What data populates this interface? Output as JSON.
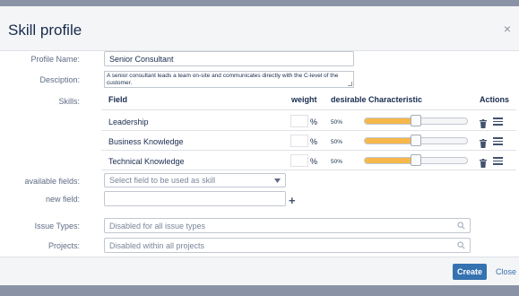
{
  "dialog": {
    "title": "Skill profile",
    "close_symbol": "×"
  },
  "form": {
    "profile_name_label": "Profile Name:",
    "profile_name_value": "Senior Consultant",
    "description_label": "Desciption:",
    "description_value": "A senior consultant leads a team on-site and communicates directly with the C-level of the customer.",
    "skills_label": "Skills:",
    "available_fields_label": "available fields:",
    "available_fields_placeholder": "Select field to be used as skill",
    "new_field_label": "new field:",
    "new_field_value": "",
    "add_symbol": "+",
    "issue_types_label": "Issue Types:",
    "issue_types_value": "Disabled for all issue types",
    "projects_label": "Projects:",
    "projects_value": "Disabled within all projects"
  },
  "table": {
    "headers": {
      "field": "Field",
      "weight": "weight",
      "characteristic": "desirable Characteristic",
      "actions": "Actions"
    },
    "percent_symbol": "%",
    "rows": [
      {
        "field": "Leadership",
        "weight": "",
        "characteristic": "50%",
        "level": 0.5
      },
      {
        "field": "Business Knowledge",
        "weight": "",
        "characteristic": "50%",
        "level": 0.5
      },
      {
        "field": "Technical Knowledge",
        "weight": "",
        "characteristic": "50%",
        "level": 0.5
      }
    ]
  },
  "icons": {
    "close": "close-icon",
    "trash": "trash-icon",
    "drag": "menu-icon",
    "search": "search-icon",
    "dropdown": "chevron-down-icon",
    "add": "plus-icon"
  },
  "colors": {
    "slider_fill": "#f6b74b",
    "primary": "#3572b0"
  },
  "footer": {
    "create_label": "Create",
    "close_label": "Close"
  }
}
